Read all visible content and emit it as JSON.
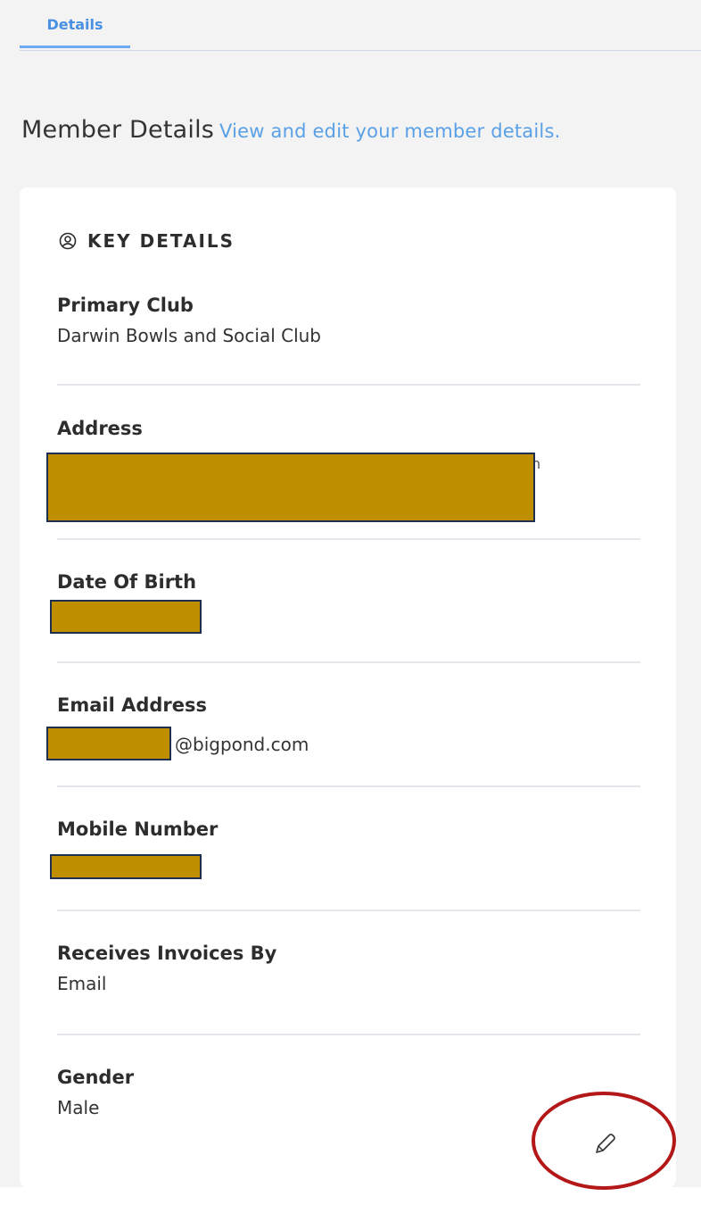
{
  "tabs": [
    {
      "label": "Details"
    }
  ],
  "page": {
    "title": "Member Details",
    "subtitle": "View and edit your member details."
  },
  "section": {
    "title": "KEY DETAILS",
    "icon": "user-circle-icon"
  },
  "fields": [
    {
      "label": "Primary Club",
      "value": "Darwin Bowls and Social Club"
    },
    {
      "label": "Address",
      "value": ""
    },
    {
      "label": "Date Of Birth",
      "value": ""
    },
    {
      "label": "Email Address",
      "value": "@bigpond.com"
    },
    {
      "label": "Mobile Number",
      "value": ""
    },
    {
      "label": "Receives Invoices By",
      "value": "Email"
    },
    {
      "label": "Gender",
      "value": "Male"
    }
  ],
  "address_tail": "n",
  "edit": {
    "icon": "pencil-icon"
  },
  "colors": {
    "accent": "#4a90e2",
    "redaction": "#bf8f00",
    "highlight_ring": "#b31717"
  }
}
